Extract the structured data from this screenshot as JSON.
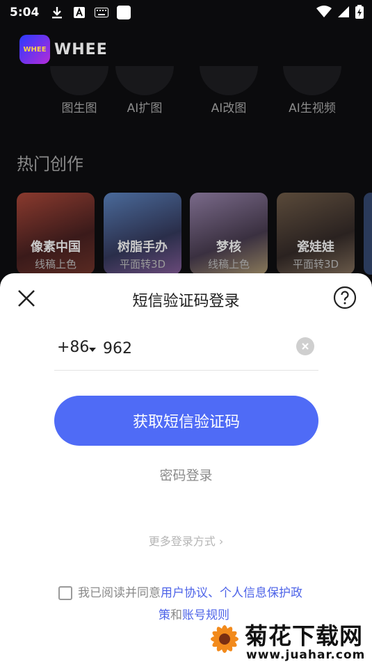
{
  "status_bar": {
    "time": "5:04"
  },
  "header": {
    "logo_text": "WHEE",
    "logo_badge_text": "WHEE"
  },
  "features": [
    {
      "label": "图生图"
    },
    {
      "label": "AI扩图"
    },
    {
      "label": "AI改图"
    },
    {
      "label": "AI生视频"
    }
  ],
  "hot_section": {
    "title": "热门创作",
    "cards": [
      {
        "title": "像素中国",
        "subtitle": "线稿上色",
        "color": "#7a2b2b"
      },
      {
        "title": "树脂手办",
        "subtitle": "平面转3D",
        "color": "#3a4a6a"
      },
      {
        "title": "梦核",
        "subtitle": "线稿上色",
        "color": "#6a5a7a"
      },
      {
        "title": "瓷娃娃",
        "subtitle": "平面转3D",
        "color": "#4a3a2a"
      }
    ]
  },
  "login_sheet": {
    "title": "短信验证码登录",
    "country_code": "+86",
    "phone_value": "962",
    "get_code_button": "获取短信验证码",
    "password_login": "密码登录",
    "more_methods": "更多登录方式 ›",
    "agreement": {
      "prefix": "我已阅读并同意",
      "user_agreement": "用户协议",
      "separator": "、",
      "privacy": "个人信息保护政",
      "privacy_cont": "策",
      "and": "和",
      "account_rules": "账号规则"
    },
    "accent_color": "#4f6bf6"
  },
  "watermark": {
    "name": "菊花下载网",
    "url": "www.juahar.com"
  }
}
